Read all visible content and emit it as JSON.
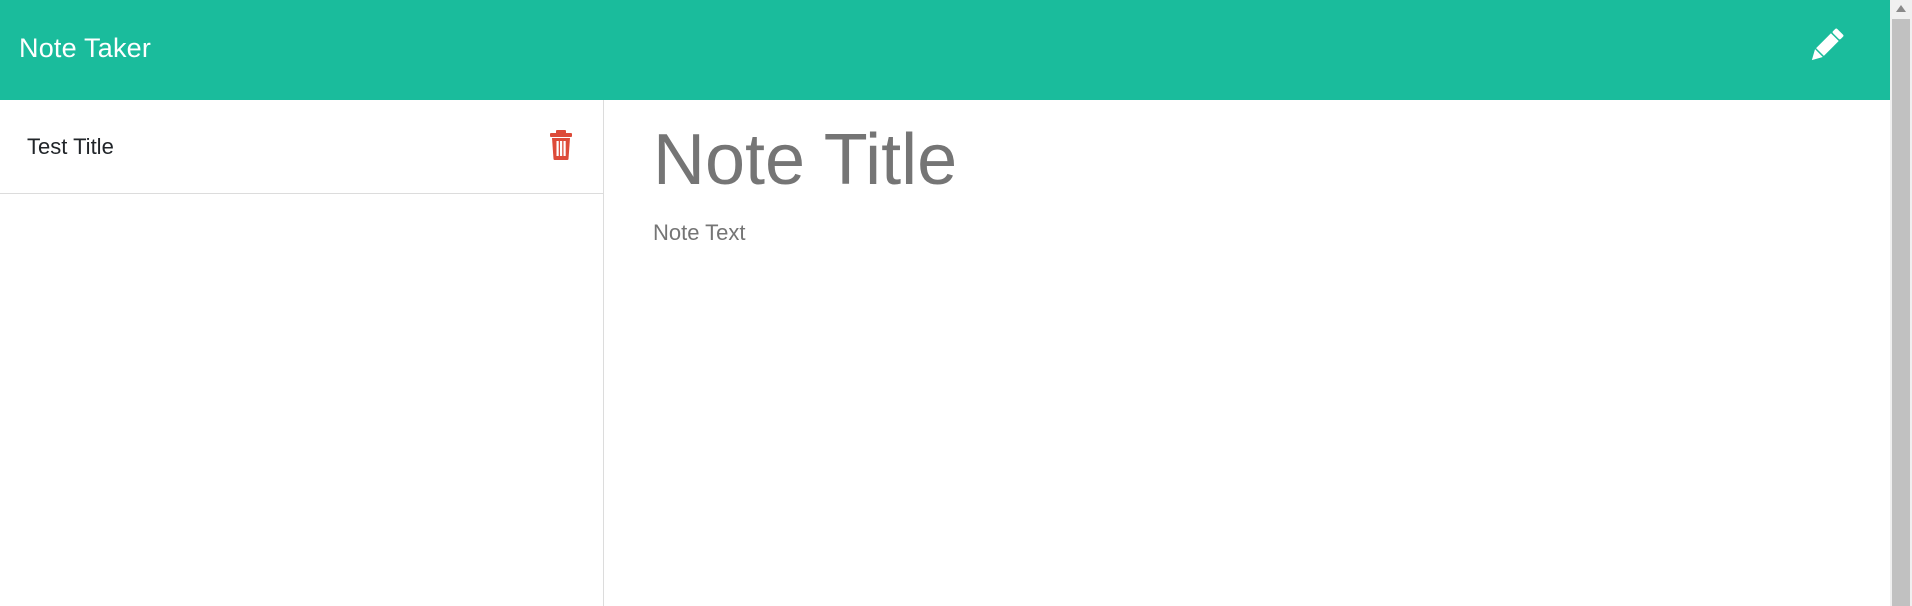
{
  "navbar": {
    "brand": "Note Taker",
    "background_color": "#1abc9c",
    "new_note_icon": "pencil-icon"
  },
  "sidebar": {
    "notes": [
      {
        "title": "Test Title",
        "delete_icon": "trash-icon"
      }
    ],
    "delete_color": "#dd4b39"
  },
  "editor": {
    "title_placeholder": "Note Title",
    "text_placeholder": "Note Text",
    "title_value": "",
    "text_value": ""
  },
  "scrollbar": {
    "thumb_color": "#c1c1c1",
    "track_color": "#f0f0f0"
  }
}
